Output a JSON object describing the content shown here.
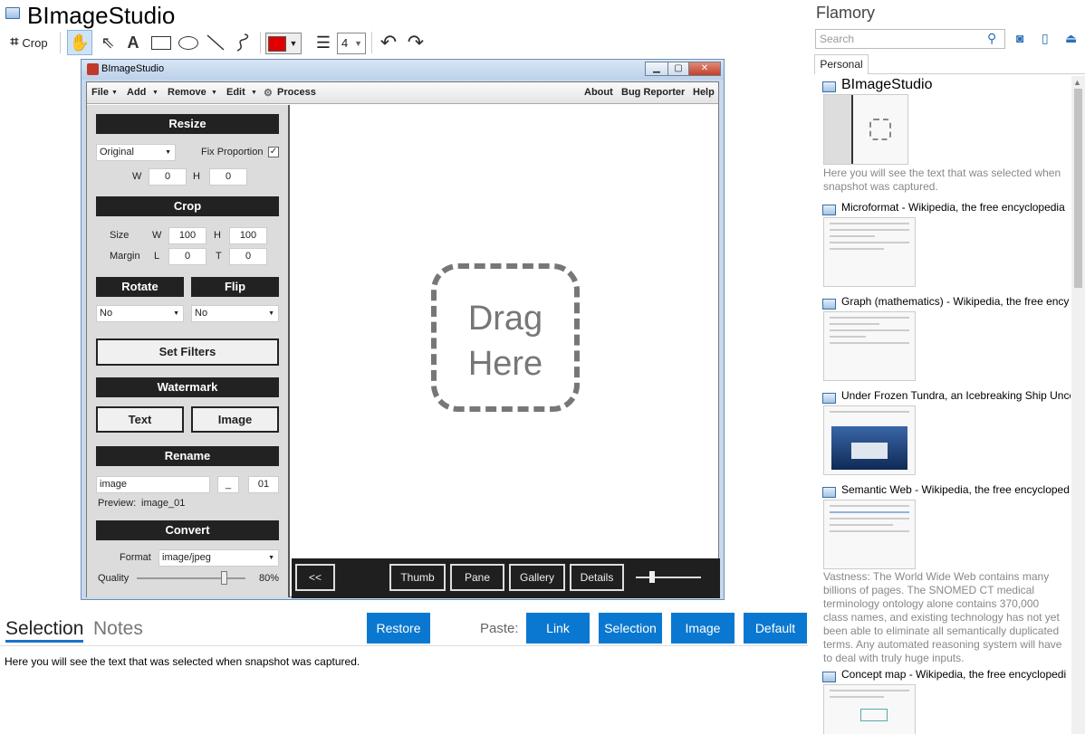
{
  "app": {
    "title": "BImageStudio",
    "icon": "window-icon"
  },
  "toolbar": {
    "crop_label": "Crop",
    "line_width": "4",
    "color": "#e00000"
  },
  "window": {
    "title": "BImageStudio",
    "menus": [
      "File",
      "Add",
      "Remove",
      "Edit",
      "Process"
    ],
    "right_menus": [
      "About",
      "Bug Reporter",
      "Help"
    ],
    "resize": {
      "header": "Resize",
      "mode": "Original",
      "fix_proportion": "Fix Proportion",
      "w_label": "W",
      "w": "0",
      "h_label": "H",
      "h": "0"
    },
    "crop": {
      "header": "Crop",
      "size_label": "Size",
      "margin_label": "Margin",
      "w_label": "W",
      "w": "100",
      "h_label": "H",
      "h": "100",
      "l_label": "L",
      "l": "0",
      "t_label": "T",
      "t": "0"
    },
    "rotate": {
      "header": "Rotate",
      "value": "No"
    },
    "flip": {
      "header": "Flip",
      "value": "No"
    },
    "set_filters": "Set Filters",
    "watermark": {
      "header": "Watermark",
      "text_btn": "Text",
      "image_btn": "Image"
    },
    "rename": {
      "header": "Rename",
      "name": "image",
      "sep": "_",
      "counter": "01",
      "preview_label": "Preview:",
      "preview_value": "image_01"
    },
    "convert": {
      "header": "Convert",
      "format_label": "Format",
      "format": "image/jpeg",
      "quality_label": "Quality",
      "quality": "80%",
      "quality_value": 0.8
    },
    "drag_line1": "Drag",
    "drag_line2": "Here",
    "bottom": {
      "back": "<<",
      "thumb": "Thumb",
      "pane": "Pane",
      "gallery": "Gallery",
      "details": "Details"
    }
  },
  "tabs": {
    "selection": "Selection",
    "notes": "Notes"
  },
  "actions": {
    "restore": "Restore",
    "paste_label": "Paste:",
    "link": "Link",
    "selection": "Selection",
    "image": "Image",
    "default": "Default"
  },
  "selection_text": "Here you will see the text that was selected when snapshot was captured.",
  "sidebar": {
    "title": "Flamory",
    "search_placeholder": "Search",
    "tab": "Personal",
    "entries": [
      {
        "title": "BImageStudio",
        "desc": "Here you will see the text that was selected when snapshot was captured."
      },
      {
        "title": "Microformat - Wikipedia, the free encyclopedia"
      },
      {
        "title": "Graph (mathematics) - Wikipedia, the free ency"
      },
      {
        "title": "Under Frozen Tundra, an Icebreaking Ship Unco"
      },
      {
        "title": "Semantic Web - Wikipedia, the free encycloped",
        "desc": "Vastness: The World Wide Web contains many billions of pages. The SNOMED CT medical terminology ontology alone contains 370,000 class names, and existing technology has not yet been able to eliminate all semantically duplicated terms. Any automated reasoning system will have to deal with truly huge inputs."
      },
      {
        "title": "Concept map - Wikipedia, the free encyclopedi"
      }
    ]
  }
}
